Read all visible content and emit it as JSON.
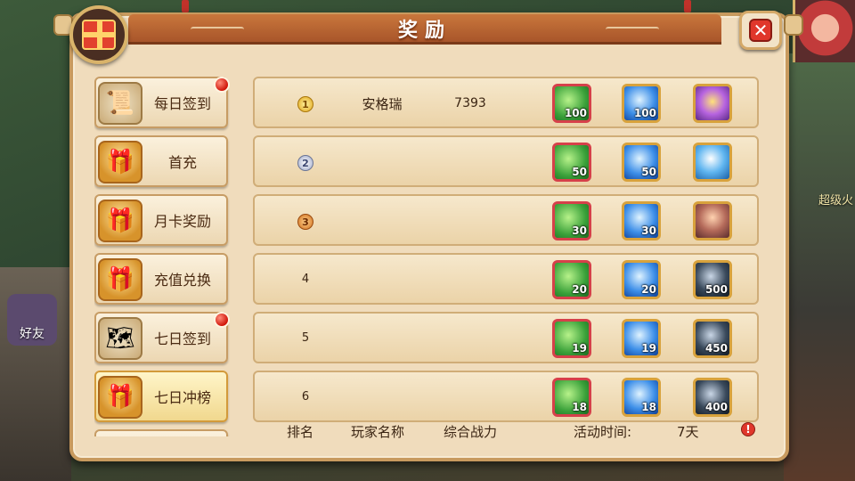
{
  "window": {
    "title": "奖励"
  },
  "background": {
    "friend_label": "好友",
    "side_hint": "超级火"
  },
  "sidebar": {
    "items": [
      {
        "label": "每日签到",
        "icon": "scroll-icon",
        "badge": true
      },
      {
        "label": "首充",
        "icon": "treasure-chest-icon",
        "badge": false
      },
      {
        "label": "月卡奖励",
        "icon": "treasure-chest-icon",
        "badge": false
      },
      {
        "label": "充值兑换",
        "icon": "treasure-chest-icon",
        "badge": false
      },
      {
        "label": "七日签到",
        "icon": "map-scroll-icon",
        "badge": true
      },
      {
        "label": "七日冲榜",
        "icon": "treasure-chest-icon",
        "badge": false,
        "active": true
      }
    ]
  },
  "ranking": {
    "rows": [
      {
        "rank": "1",
        "name": "安格瑞",
        "power": "7393",
        "leaf": "100",
        "gem": "100",
        "item_icon": "purple-crystal-icon",
        "item_count": ""
      },
      {
        "rank": "2",
        "name": "",
        "power": "",
        "leaf": "50",
        "gem": "50",
        "item_icon": "penguin-icon",
        "item_count": ""
      },
      {
        "rank": "3",
        "name": "",
        "power": "",
        "leaf": "30",
        "gem": "30",
        "item_icon": "hero-portrait-icon",
        "item_count": ""
      },
      {
        "rank": "4",
        "name": "",
        "power": "",
        "leaf": "20",
        "gem": "20",
        "item_icon": "ore-icon",
        "item_count": "500"
      },
      {
        "rank": "5",
        "name": "",
        "power": "",
        "leaf": "19",
        "gem": "19",
        "item_icon": "ore-icon",
        "item_count": "450"
      },
      {
        "rank": "6",
        "name": "",
        "power": "",
        "leaf": "18",
        "gem": "18",
        "item_icon": "ore-icon",
        "item_count": "400"
      }
    ]
  },
  "footer": {
    "col_rank": "排名",
    "col_name": "玩家名称",
    "col_power": "综合战力",
    "time_label": "活动时间:",
    "time_value": "7天",
    "info_symbol": "!"
  },
  "close": {
    "symbol": "✕"
  },
  "colors": {
    "accent": "#c9773c",
    "panel": "#f0dcbc",
    "badge_red": "#d0150a"
  }
}
